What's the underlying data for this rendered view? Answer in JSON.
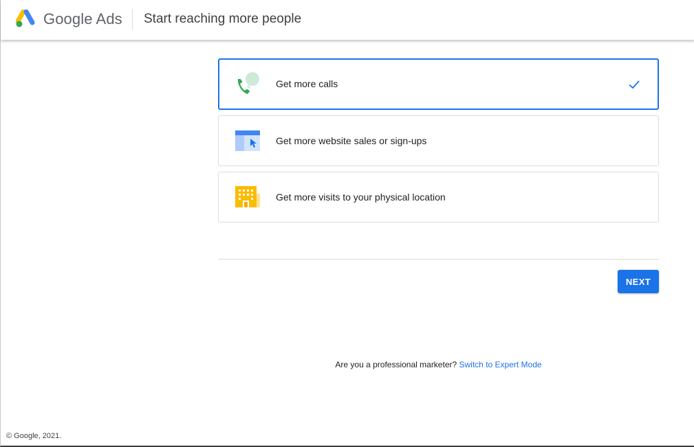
{
  "header": {
    "logo_text": "Google Ads",
    "title": "Start reaching more people",
    "logo_icon": "google-ads-logo"
  },
  "goals": [
    {
      "label": "Get more calls",
      "icon": "phone-chat-icon",
      "selected": true
    },
    {
      "label": "Get more website sales or sign-ups",
      "icon": "browser-cursor-icon",
      "selected": false
    },
    {
      "label": "Get more visits to your physical location",
      "icon": "building-icon",
      "selected": false
    }
  ],
  "next_button": {
    "label": "NEXT"
  },
  "expert_mode": {
    "prompt": "Are you a professional marketer?",
    "link": "Switch to Expert Mode"
  },
  "footer": {
    "copyright": "© Google, 2021."
  },
  "colors": {
    "accent": "#1a73e8",
    "phone_green": "#34a853",
    "bubble_green": "#ceead6",
    "building_yellow": "#fbbc04",
    "browser_blue": "#4285f4"
  }
}
